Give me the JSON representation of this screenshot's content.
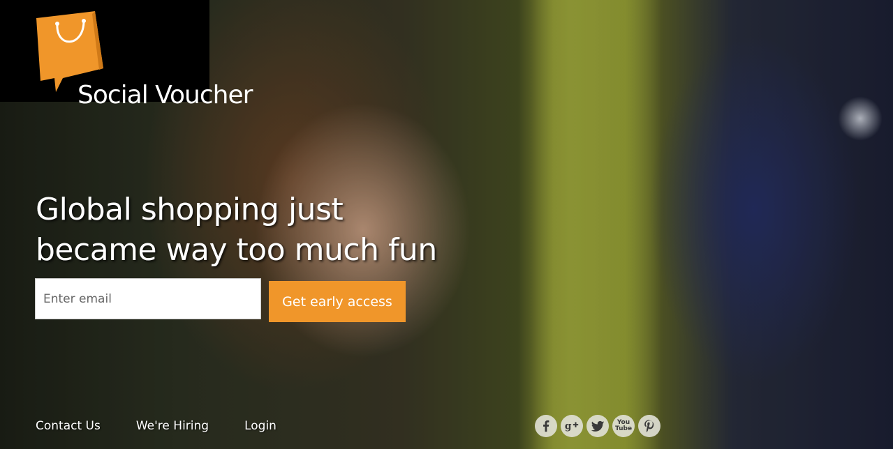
{
  "brand": {
    "name": "Social Voucher",
    "accent_color": "#f0962a"
  },
  "hero": {
    "headline_line1": "Global shopping just",
    "headline_line2": "became way too much fun"
  },
  "signup": {
    "email_placeholder": "Enter email",
    "cta_label": "Get early access"
  },
  "footer": {
    "links": [
      {
        "label": "Contact Us"
      },
      {
        "label": "We're Hiring"
      },
      {
        "label": "Login"
      }
    ],
    "social_icons": [
      "facebook-icon",
      "google-plus-icon",
      "twitter-icon",
      "youtube-icon",
      "pinterest-icon"
    ],
    "youtube_icon_text": "You Tube"
  }
}
